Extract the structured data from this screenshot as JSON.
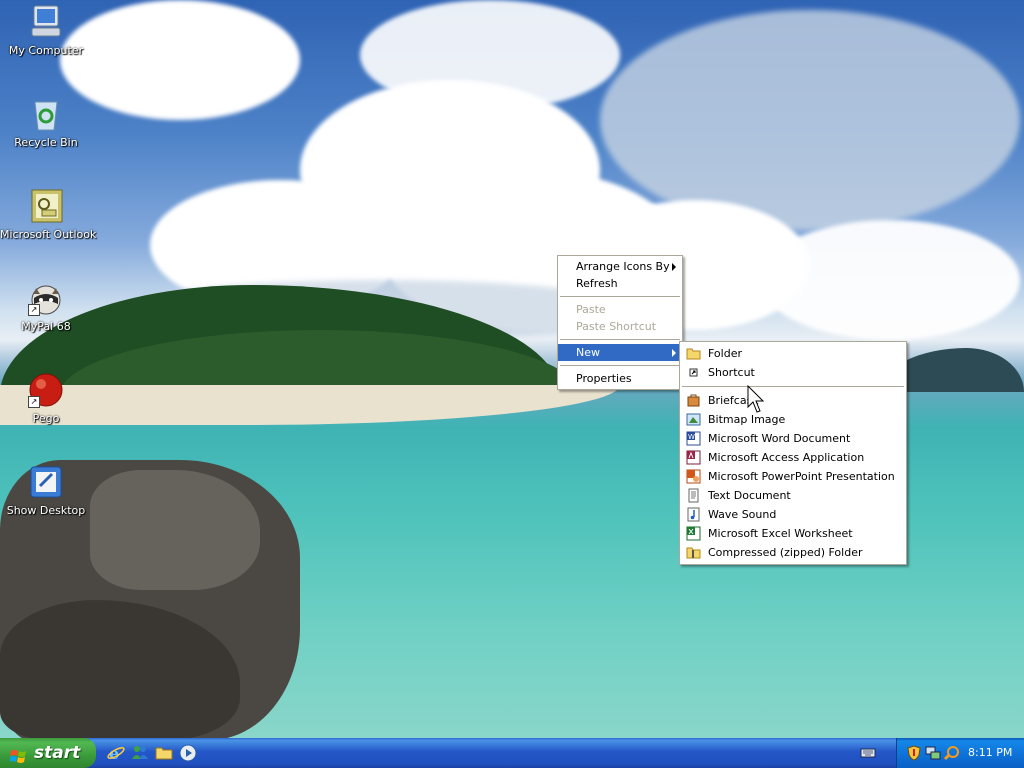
{
  "desktop": {
    "icons": [
      {
        "label": "My Computer",
        "icon": "computer-icon",
        "shortcut": false
      },
      {
        "label": "Recycle Bin",
        "icon": "recycle-bin-icon",
        "shortcut": false
      },
      {
        "label": "Microsoft Outlook",
        "icon": "outlook-icon",
        "shortcut": false
      },
      {
        "label": "MyPal 68",
        "icon": "raccoon-icon",
        "shortcut": true
      },
      {
        "label": "Pego",
        "icon": "red-ball-icon",
        "shortcut": true
      },
      {
        "label": "Show Desktop",
        "icon": "show-desktop-icon",
        "shortcut": false
      }
    ]
  },
  "context_menu": {
    "items": [
      {
        "label": "Arrange Icons By",
        "submenu": true,
        "disabled": false
      },
      {
        "label": "Refresh",
        "submenu": false,
        "disabled": false
      },
      {
        "label": "Paste",
        "submenu": false,
        "disabled": true
      },
      {
        "label": "Paste Shortcut",
        "submenu": false,
        "disabled": true
      },
      {
        "label": "New",
        "submenu": true,
        "disabled": false,
        "selected": true
      },
      {
        "label": "Properties",
        "submenu": false,
        "disabled": false
      }
    ]
  },
  "new_submenu": {
    "items": [
      {
        "label": "Folder",
        "icon": "folder-icon"
      },
      {
        "label": "Shortcut",
        "icon": "shortcut-icon"
      },
      {
        "label": "Briefcase",
        "icon": "briefcase-icon"
      },
      {
        "label": "Bitmap Image",
        "icon": "bitmap-icon"
      },
      {
        "label": "Microsoft Word Document",
        "icon": "word-icon"
      },
      {
        "label": "Microsoft Access Application",
        "icon": "access-icon"
      },
      {
        "label": "Microsoft PowerPoint Presentation",
        "icon": "powerpoint-icon"
      },
      {
        "label": "Text Document",
        "icon": "text-document-icon"
      },
      {
        "label": "Wave Sound",
        "icon": "wave-sound-icon"
      },
      {
        "label": "Microsoft Excel Worksheet",
        "icon": "excel-icon"
      },
      {
        "label": "Compressed (zipped) Folder",
        "icon": "zip-folder-icon"
      }
    ]
  },
  "taskbar": {
    "start_label": "start",
    "quick_launch": [
      "internet-explorer-icon",
      "messenger-icon",
      "explorer-folder-icon",
      "media-player-icon"
    ],
    "tray_icons": [
      "security-shield-icon",
      "network-icon",
      "search-icon"
    ],
    "clock": "8:11 PM"
  },
  "colors": {
    "menu_highlight": "#316ac5",
    "taskbar_blue": "#2457c8",
    "start_green": "#3a9a3a",
    "tray_blue": "#0f74da"
  }
}
